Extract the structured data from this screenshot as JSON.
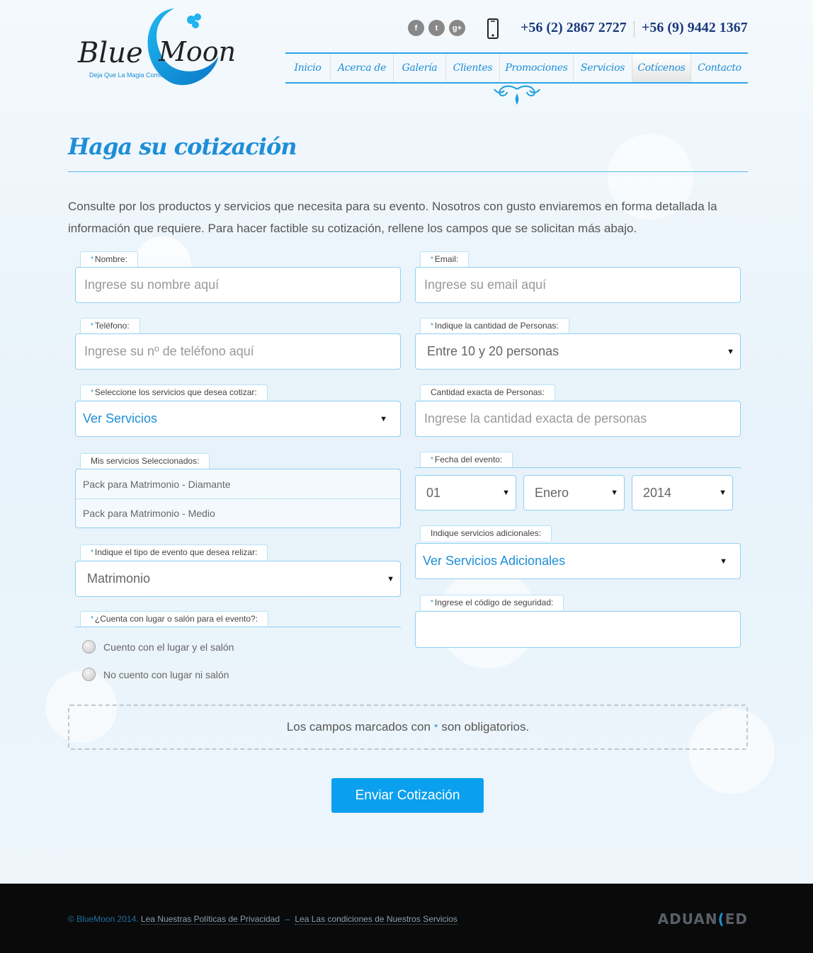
{
  "header": {
    "logo": {
      "name_part1": "Blue",
      "name_part2": "Moon",
      "tagline": "Deja Que La Magia Comience"
    },
    "social": [
      {
        "icon": "facebook-icon",
        "glyph": "f"
      },
      {
        "icon": "twitter-icon",
        "glyph": "t"
      },
      {
        "icon": "google-plus-icon",
        "glyph": "g+"
      }
    ],
    "phone_icon": "mobile-phone-icon",
    "phone1": "+56 (2) 2867 2727",
    "phone2": "+56 (9) 9442 1367"
  },
  "nav": {
    "items": [
      {
        "label": "Inicio",
        "active": false
      },
      {
        "label": "Acerca de",
        "active": false
      },
      {
        "label": "Galería",
        "active": false
      },
      {
        "label": "Clientes",
        "active": false
      },
      {
        "label": "Promociones",
        "active": false
      },
      {
        "label": "Servicios",
        "active": false
      },
      {
        "label": "Cotícenos",
        "active": true
      },
      {
        "label": "Contacto",
        "active": false
      }
    ]
  },
  "page": {
    "title": "Haga su cotización",
    "intro": "Consulte por los productos y servicios que necesita para su evento. Nosotros con gusto enviaremos en forma detallada la información que requiere. Para hacer factible su cotización, rellene los campos que se solicitan más abajo."
  },
  "form": {
    "nombre": {
      "label": "Nombre:",
      "placeholder": "Ingrese su nombre aquí"
    },
    "email": {
      "label": "Email:",
      "placeholder": "Ingrese su email aquí"
    },
    "telefono": {
      "label": "Teléfono:",
      "placeholder": "Ingrese su nº de teléfono aquí"
    },
    "personas": {
      "label": "Indique la cantidad de Personas:",
      "value": "Entre 10 y 20 personas"
    },
    "servicios": {
      "label": "Seleccione los servicios que desea cotizar:",
      "value": "Ver Servicios"
    },
    "cantidad_exacta": {
      "label": "Cantidad exacta de Personas:",
      "placeholder": "Ingrese la cantidad exacta de personas"
    },
    "seleccionados": {
      "label": "Mis servicios Seleccionados:",
      "items": [
        "Pack para Matrimonio - Diamante",
        "Pack para Matrimonio - Medio"
      ]
    },
    "fecha": {
      "label": "Fecha del evento:",
      "day": "01",
      "month": "Enero",
      "year": "2014"
    },
    "tipo_evento": {
      "label": "Indique el tipo de evento que desea relizar:",
      "value": "Matrimonio"
    },
    "adicionales": {
      "label": "Indique servicios adicionales:",
      "value": "Ver Servicios Adicionales"
    },
    "lugar": {
      "label": "¿Cuenta con lugar o salón para el evento?:",
      "options": [
        "Cuento con el lugar y el salón",
        "No cuento con lugar ni salón"
      ]
    },
    "codigo": {
      "label": "Ingrese el código de seguridad:",
      "value": ""
    },
    "required_mark": "*",
    "notice_before": "Los campos marcados con",
    "notice_after": "son obligatorios.",
    "submit_label": "Enviar Cotización"
  },
  "footer": {
    "copyright": "© BlueMoon 2014.",
    "privacy_link": "Lea Nuestras Políticas de Privacidad",
    "separator": "–",
    "terms_link": "Lea Las condiciones de Nuestros Servicios",
    "brand_part1": "ADUAN",
    "brand_part2": "ED"
  },
  "colors": {
    "accent": "#1e8ed8",
    "nav_border": "#2aa4e8",
    "button": "#0aa0ef",
    "footer_bg": "#0a0a0a"
  }
}
